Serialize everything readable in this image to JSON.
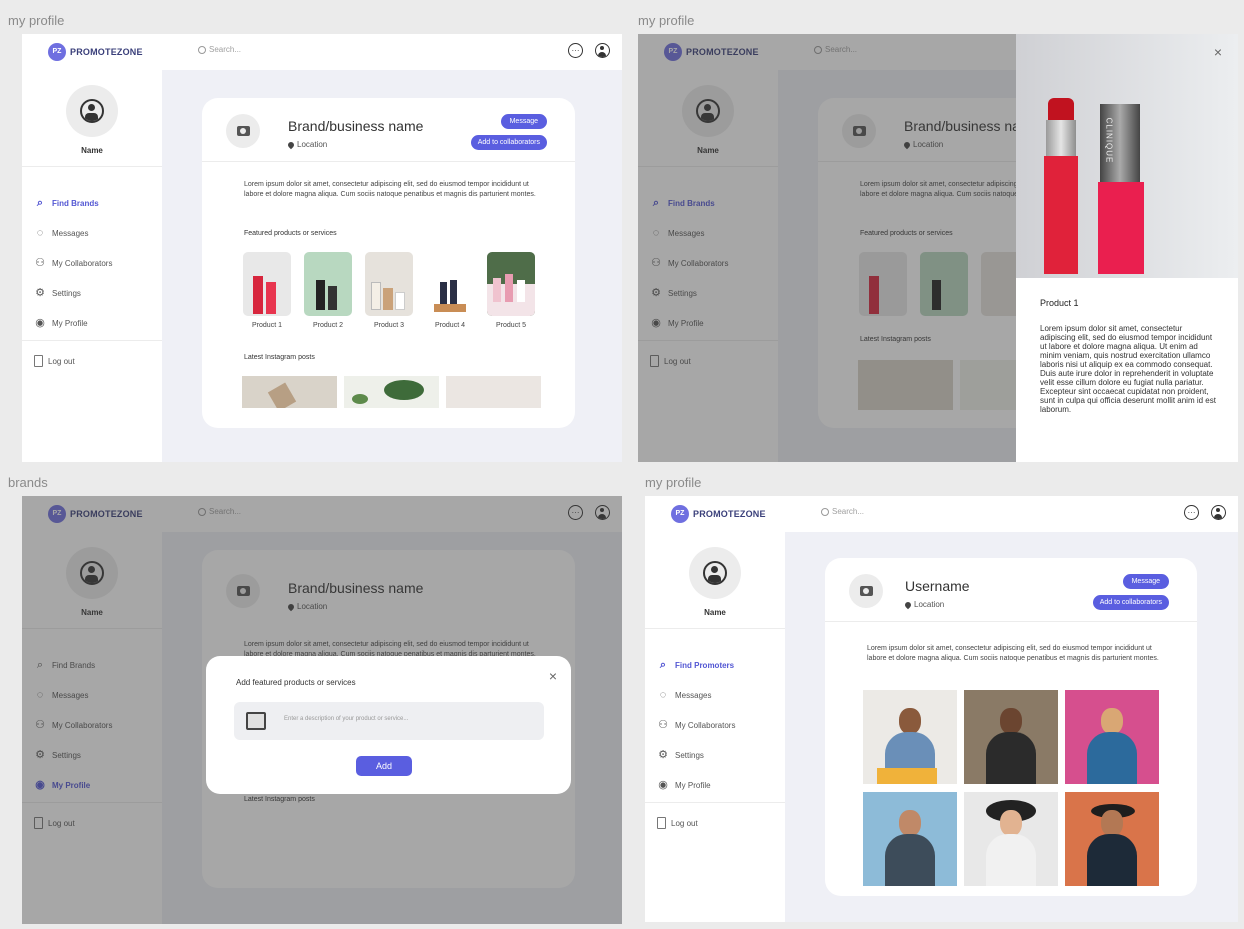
{
  "frames": [
    {
      "label": "my profile"
    },
    {
      "label": "my profile"
    },
    {
      "label": "brands"
    },
    {
      "label": "my profile"
    }
  ],
  "app": {
    "logo_text": "PROMOTEZONE",
    "logo_mark": "PZ",
    "search_placeholder": "Search...",
    "messages_icon": "chat-bubble",
    "account_icon": "user-circle"
  },
  "sidebar": {
    "name": "Name",
    "brand_items": [
      {
        "label": "Find Brands",
        "icon": "search-brand-icon"
      },
      {
        "label": "Messages",
        "icon": "chat-icon"
      },
      {
        "label": "My Collaborators",
        "icon": "people-icon"
      },
      {
        "label": "Settings",
        "icon": "gear-icon"
      },
      {
        "label": "My Profile",
        "icon": "user-circle-icon"
      }
    ],
    "promoter_items": [
      {
        "label": "Find Promoters",
        "icon": "search-icon"
      },
      {
        "label": "Messages",
        "icon": "chat-icon"
      },
      {
        "label": "My Collaborators",
        "icon": "people-icon"
      },
      {
        "label": "Settings",
        "icon": "gear-icon"
      },
      {
        "label": "My Profile",
        "icon": "user-circle-icon"
      }
    ],
    "logout": "Log out"
  },
  "brand_profile": {
    "name": "Brand/business name",
    "location": "Location",
    "message_button": "Message",
    "collab_button": "Add to collaborators",
    "description": "Lorem ipsum dolor sit amet, consectetur adipiscing elit, sed do eiusmod tempor incididunt ut labore et dolore magna aliqua. Cum sociis natoque penatibus et magnis dis parturient montes.",
    "featured_title": "Featured products or services",
    "products": [
      "Product 1",
      "Product 2",
      "Product 3",
      "Product 4",
      "Product 5"
    ],
    "instagram_title": "Latest Instagram posts"
  },
  "product_panel": {
    "close": "×",
    "title": "Product 1",
    "bottle_label": "CLINIQUE",
    "description": "Lorem ipsum dolor sit amet, consectetur adipiscing elit, sed do eiusmod tempor incididunt ut labore et dolore magna aliqua. Ut enim ad minim veniam, quis nostrud exercitation ullamco laboris nisi ut aliquip ex ea commodo consequat. Duis aute irure dolor in reprehenderit in voluptate velit esse cillum dolore eu fugiat nulla pariatur. Excepteur sint occaecat cupidatat non proident, sunt in culpa qui officia deserunt mollit anim id est laborum."
  },
  "add_modal": {
    "title": "Add featured products or services",
    "close": "×",
    "placeholder": "Enter a description of your product or service...",
    "add_button": "Add"
  },
  "promoter_profile": {
    "name": "Username",
    "location": "Location",
    "message_button": "Message",
    "collab_button": "Add to collaborators",
    "description": "Lorem ipsum dolor sit amet, consectetur adipiscing elit, sed do eiusmod tempor incididunt ut labore et dolore magna aliqua. Cum sociis natoque penatibus et magnis dis parturient montes."
  },
  "colors": {
    "accent": "#5a5ee0",
    "background": "#eff0f6",
    "overlay": "#3c3c3c"
  }
}
